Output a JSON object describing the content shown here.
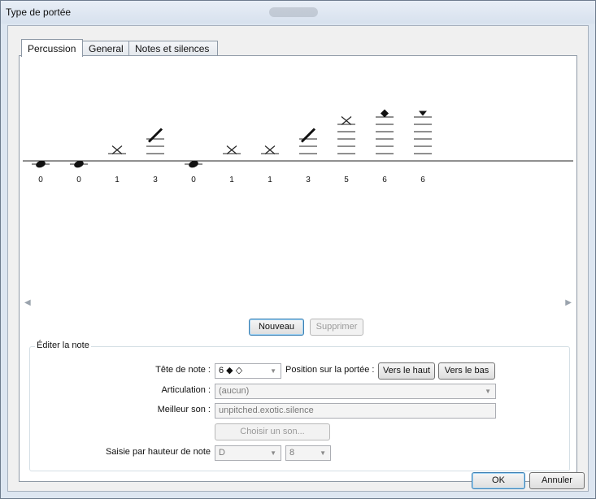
{
  "window": {
    "title": "Type de portée"
  },
  "tabs": [
    {
      "label": "Percussion",
      "active": true
    },
    {
      "label": "General",
      "active": false
    },
    {
      "label": "Notes et silences",
      "active": false
    }
  ],
  "staff": {
    "notes": [
      {
        "head": "normal",
        "position": 0
      },
      {
        "head": "normal",
        "position": 0
      },
      {
        "head": "x",
        "position": 1
      },
      {
        "head": "slash",
        "position": 3
      },
      {
        "head": "normal",
        "position": 0
      },
      {
        "head": "x",
        "position": 1
      },
      {
        "head": "x",
        "position": 1
      },
      {
        "head": "slash",
        "position": 3
      },
      {
        "head": "x",
        "position": 5
      },
      {
        "head": "diamond",
        "position": 6
      },
      {
        "head": "triangle",
        "position": 6
      }
    ]
  },
  "buttons": {
    "new": "Nouveau",
    "delete": "Supprimer",
    "up": "Vers le haut",
    "down": "Vers le bas",
    "choose_sound": "Choisir un son...",
    "ok": "OK",
    "cancel": "Annuler"
  },
  "edit": {
    "group_label": "Éditer la note",
    "notehead_label": "Tête de note :",
    "notehead_glyphs": "6  ◆  ◇",
    "position_label": "Position sur la portée :",
    "articulation_label": "Articulation :",
    "articulation_value": "(aucun)",
    "best_sound_label": "Meilleur son :",
    "best_sound_value": "unpitched.exotic.silence",
    "pitch_input_label": "Saisie par hauteur de note",
    "pitch_note_value": "D",
    "pitch_octave_value": "8"
  },
  "icons": {
    "scroll_left": "scroll-left-arrow",
    "scroll_right": "scroll-right-arrow",
    "combo_caret": "chevron-down"
  }
}
